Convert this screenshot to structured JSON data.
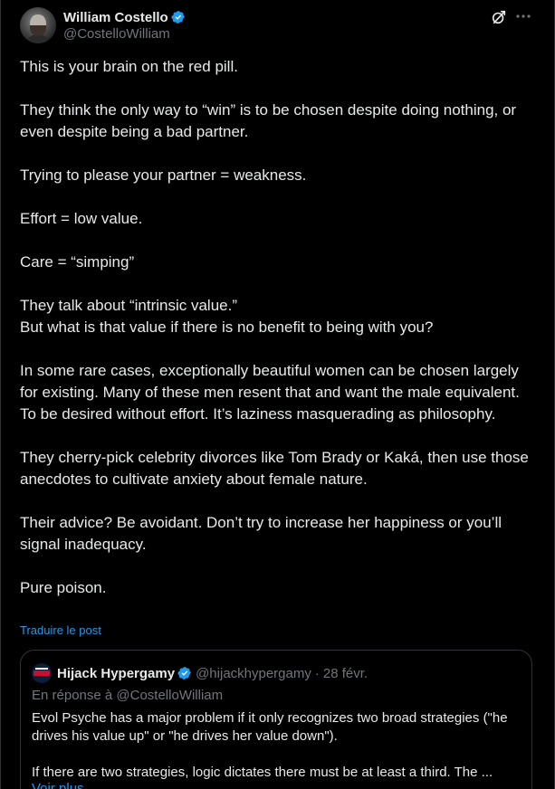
{
  "author": {
    "display_name": "William Costello",
    "handle": "@CostelloWilliam"
  },
  "icons": {
    "verified": "verified-badge-icon",
    "grok": "grok-icon",
    "more": "more-options-icon"
  },
  "colors": {
    "background": "#000000",
    "text": "#e7e9ea",
    "muted": "#71767b",
    "link": "#1d9bf0",
    "verified": "#1d9bf0",
    "border": "#2f3336"
  },
  "tweet": {
    "paragraphs": [
      "This is your brain on the red pill.",
      "They think the only way to “win” is to be chosen despite doing nothing, or even despite being a bad partner.",
      "Trying to please your partner = weakness.",
      "Effort = low value.",
      "Care = “simping”",
      "They talk about “intrinsic value.”\nBut what is that value if there is no benefit to being with you?",
      "In some rare cases, exceptionally beautiful women can be chosen largely for existing. Many of these men resent that and want the male equivalent. To be desired without effort. It’s laziness masquerading as philosophy.",
      "They cherry-pick celebrity divorces like Tom Brady or Kaká, then use those anecdotes to cultivate anxiety about female nature.",
      "Their advice? Be avoidant. Don’t try to increase her happiness or you’ll signal inadequacy.",
      "Pure poison."
    ],
    "translate_label": "Traduire le post"
  },
  "quote": {
    "display_name": "Hijack Hypergamy",
    "handle": "@hijackhypergamy",
    "separator": "·",
    "date": "28 févr.",
    "reply_context": "En réponse à @CostelloWilliam",
    "paragraphs": [
      "Evol Psyche has a major problem if it only recognizes two broad strategies (\"he drives his value up\" or \"he drives her value down\").",
      "If there are two strategies, logic dictates there must be at least a third. The ..."
    ],
    "more_label": "Voir plus"
  }
}
